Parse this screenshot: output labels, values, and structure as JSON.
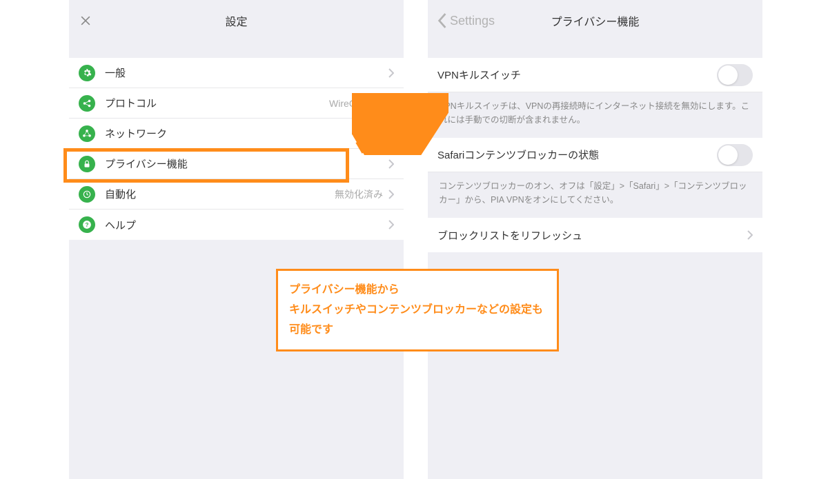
{
  "leftPanel": {
    "title": "設定",
    "items": [
      {
        "label": "一般",
        "value": ""
      },
      {
        "label": "プロトコル",
        "value": "WireGuard®"
      },
      {
        "label": "ネットワーク",
        "value": ""
      },
      {
        "label": "プライバシー機能",
        "value": ""
      },
      {
        "label": "自動化",
        "value": "無効化済み"
      },
      {
        "label": "ヘルプ",
        "value": ""
      }
    ]
  },
  "rightPanel": {
    "backLabel": "Settings",
    "title": "プライバシー機能",
    "killSwitch": {
      "label": "VPNキルスイッチ",
      "desc": "VPNキルスイッチは、VPNの再接続時にインターネット接続を無効にします。これには手動での切断が含まれません。"
    },
    "contentBlocker": {
      "label": "Safariコンテンツブロッカーの状態",
      "desc": "コンテンツブロッカーのオン、オフは「設定」>「Safari」>「コンテンツブロッカー」から、PIA VPNをオンにしてください。"
    },
    "refresh": {
      "label": "ブロックリストをリフレッシュ"
    }
  },
  "annotation": {
    "line1": "プライバシー機能から",
    "line2": "キルスイッチやコンテンツブロッカーなどの設定も可能です"
  }
}
